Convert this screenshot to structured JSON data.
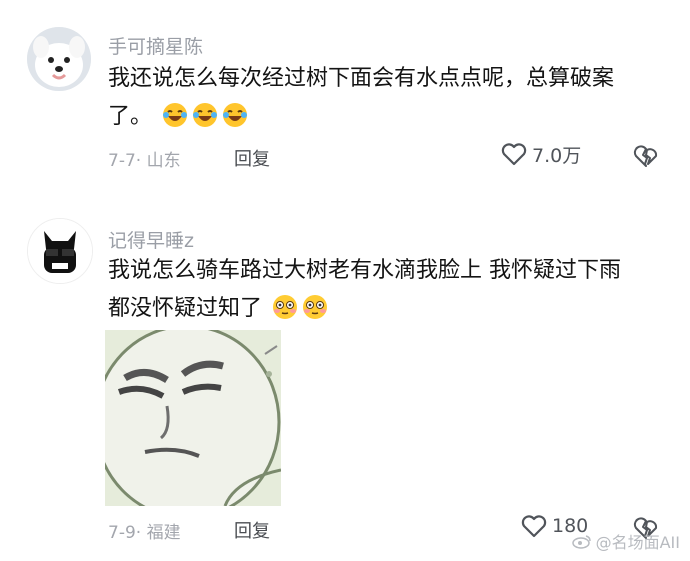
{
  "comments": [
    {
      "username": "手可摘星陈",
      "text": "我还说怎么每次经过树下面会有水点点呢，总算破案了。",
      "meta": "7-7· 山东",
      "reply_label": "回复",
      "likes": "7.0万",
      "emojis": [
        "laughing-crying-emoji",
        "laughing-crying-emoji",
        "laughing-crying-emoji"
      ]
    },
    {
      "username": "记得早睡z",
      "text": "我说怎么骑车路过大树老有水滴我脸上 我怀疑过下雨都没怀疑过知了",
      "meta": "7-9· 福建",
      "reply_label": "回复",
      "likes": "180",
      "emojis": [
        "flushed-emoji",
        "flushed-emoji"
      ]
    }
  ],
  "watermark": "@名场面AII"
}
